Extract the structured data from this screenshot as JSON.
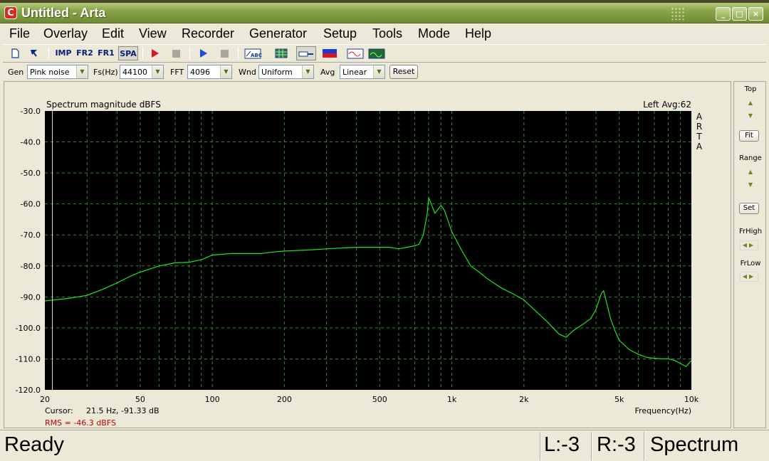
{
  "window": {
    "title": "Untitled - Arta",
    "icon": "arta-app-icon",
    "minimize_glyph": "_",
    "maximize_glyph": "□",
    "close_glyph": "×"
  },
  "menu": [
    "File",
    "Overlay",
    "Edit",
    "View",
    "Recorder",
    "Generator",
    "Setup",
    "Tools",
    "Mode",
    "Help"
  ],
  "toolbar": {
    "buttons": [
      {
        "name": "new-file-icon",
        "label": ""
      },
      {
        "name": "open-file-icon",
        "label": ""
      },
      {
        "name": "imp-mode-button",
        "label": "IMP"
      },
      {
        "name": "fr2-mode-button",
        "label": "FR2"
      },
      {
        "name": "fr1-mode-button",
        "label": "FR1"
      },
      {
        "name": "spa-mode-button",
        "label": "SPA",
        "pressed": true
      },
      {
        "name": "record-icon",
        "label": ""
      },
      {
        "name": "stop-icon",
        "label": ""
      },
      {
        "name": "play-icon",
        "label": ""
      },
      {
        "name": "stop2-icon",
        "label": ""
      },
      {
        "name": "scope-abc-icon",
        "label": ""
      },
      {
        "name": "grid-icon",
        "label": ""
      },
      {
        "name": "probe-icon",
        "label": ""
      },
      {
        "name": "levels-icon",
        "label": ""
      },
      {
        "name": "signal-wave-icon",
        "label": ""
      },
      {
        "name": "scope-wave-icon",
        "label": ""
      }
    ],
    "colors": {
      "record": "#e0141e",
      "play": "#1a4fd6",
      "disabled": "#a9a79a"
    }
  },
  "genbar": {
    "gen_label": "Gen",
    "gen_value": "Pink noise",
    "fs_label": "Fs(Hz)",
    "fs_value": "44100",
    "fft_label": "FFT",
    "fft_value": "4096",
    "wnd_label": "Wnd",
    "wnd_value": "Uniform",
    "avg_label": "Avg",
    "avg_value": "Linear",
    "reset_label": "Reset"
  },
  "chart_header": {
    "title": "Spectrum magnitude dBFS",
    "avg_info": "Left  Avg:62",
    "brand_vertical": [
      "A",
      "R",
      "T",
      "A"
    ]
  },
  "cursor_readout": {
    "label": "Cursor:",
    "value": "21.5 Hz, -91.33 dB"
  },
  "rms_readout": {
    "text": "RMS =  -46.3 dBFS",
    "color": "#c00000"
  },
  "right_panel": {
    "top_label": "Top",
    "fit_label": "Fit",
    "range_label": "Range",
    "set_label": "Set",
    "frhigh_label": "FrHigh",
    "frlow_label": "FrLow"
  },
  "status": {
    "ready": "Ready",
    "left_level": "L:-3",
    "right_level": "R:-3",
    "mode": "Spectrum"
  },
  "chart_data": {
    "type": "line",
    "title": "Spectrum magnitude dBFS",
    "xlabel": "Frequency(Hz)",
    "ylabel": "",
    "xscale": "log",
    "xlim": [
      20,
      10000
    ],
    "ylim": [
      -120,
      -30
    ],
    "x_ticks": [
      "20",
      "50",
      "100",
      "200",
      "500",
      "1k",
      "2k",
      "5k",
      "10k"
    ],
    "y_ticks": [
      "-30.0",
      "-40.0",
      "-50.0",
      "-60.0",
      "-70.0",
      "-80.0",
      "-90.0",
      "-100.0",
      "-110.0",
      "-120.0"
    ],
    "grid": true,
    "background": "#000000",
    "line_color": "#1ee31e",
    "cursor_x": 21.5,
    "series": [
      {
        "x": [
          20,
          25,
          30,
          35,
          40,
          45,
          50,
          55,
          60,
          65,
          70,
          80,
          90,
          100,
          120,
          140,
          160,
          180,
          200,
          230,
          260,
          300,
          350,
          400,
          450,
          500,
          550,
          600,
          650,
          700,
          730,
          760,
          790,
          800,
          820,
          850,
          880,
          900,
          930,
          950,
          1000,
          1100,
          1200,
          1300,
          1400,
          1600,
          1800,
          2000,
          2200,
          2500,
          2800,
          3000,
          3200,
          3500,
          3800,
          4000,
          4200,
          4300,
          4400,
          4600,
          4800,
          5000,
          5500,
          6000,
          6500,
          7000,
          7500,
          8000,
          8500,
          9000,
          9500,
          10000
        ],
        "y": [
          -91.3,
          -90.5,
          -89.5,
          -87.5,
          -85.5,
          -83.5,
          -82,
          -81,
          -80,
          -79.5,
          -79,
          -78.8,
          -78,
          -76.5,
          -76,
          -76,
          -76,
          -75.5,
          -75.2,
          -75,
          -74.8,
          -74.5,
          -74.2,
          -74,
          -74,
          -74,
          -74,
          -74.5,
          -74,
          -73.5,
          -73,
          -70,
          -63,
          -58,
          -60,
          -63,
          -61.5,
          -60.5,
          -62,
          -64,
          -69,
          -75,
          -80,
          -82,
          -84,
          -87,
          -89,
          -91,
          -94,
          -98,
          -102,
          -103,
          -101,
          -99,
          -97,
          -94,
          -89,
          -88,
          -91,
          -97,
          -101,
          -104,
          -107,
          -108.5,
          -109.5,
          -109.8,
          -110,
          -110,
          -110.5,
          -111.5,
          -112.5,
          -110.5
        ]
      }
    ]
  }
}
